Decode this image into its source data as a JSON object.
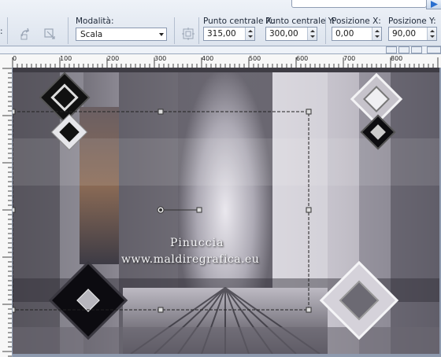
{
  "toolbar": {
    "mode_label": "Modalità:",
    "mode_value": "Scala",
    "center_x_label": "Punto centrale X:",
    "center_x_value": "315,00",
    "center_y_label": "Punto centrale Y:",
    "center_y_value": "300,00",
    "pos_x_label": "Posizione X:",
    "pos_x_value": "0,00",
    "pos_y_label": "Posizione Y:",
    "pos_y_value": "90,00"
  },
  "ruler": {
    "h_labels": [
      "0",
      "100",
      "200",
      "300",
      "400",
      "500",
      "600",
      "700",
      "800"
    ]
  },
  "canvas": {
    "watermark_line1": "Pinuccia",
    "watermark_line2": "www.maldiregrafica.eu"
  },
  "icons": {
    "left_btn1": "rotate-icon",
    "left_btn2": "transform-icon",
    "center_btn": "center-target-icon",
    "run": "play-icon"
  },
  "colors": {
    "toolbar_bg": "#dde4ee",
    "accent_blue": "#2a6fcf"
  }
}
